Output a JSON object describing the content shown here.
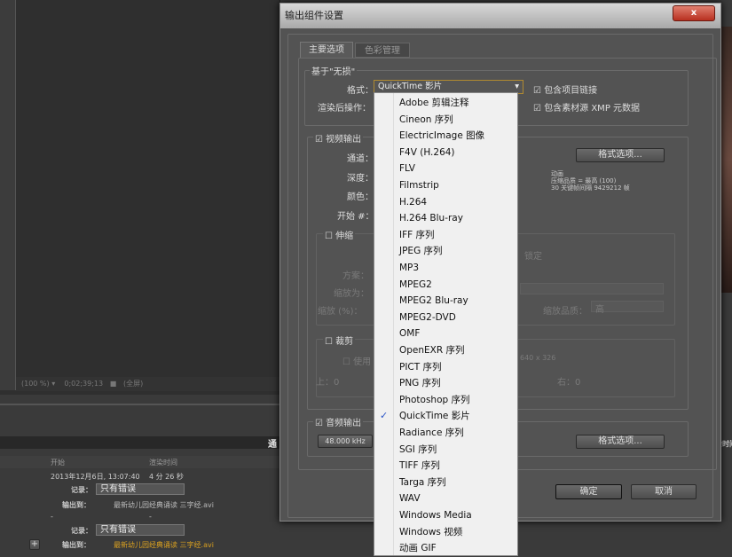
{
  "viewer_toolbar": {
    "zoom": "(100 %)",
    "timecode": "0;02;39;13",
    "view": "(全屏)"
  },
  "queue": {
    "columns": [
      "开始",
      "渲染时间"
    ],
    "rows": [
      {
        "start": "2013年12月6日, 13:07:40",
        "render_time": "4 分 26 秒",
        "log_label": "记录：",
        "log_value": "只有错误",
        "output_label": "输出到：",
        "output_file": "最新幼儿园经典诵读 三字经.avi"
      },
      {
        "start": "-",
        "render_time": "-",
        "log_label": "记录：",
        "log_value": "只有错误",
        "output_label": "输出到：",
        "output_file": "最新幼儿园经典诵读 三字经.avi"
      }
    ],
    "panel_label_left": "通",
    "panel_label_right": "余时间"
  },
  "dialog": {
    "title": "输出组件设置",
    "close": "x",
    "tabs": [
      "主要选项",
      "色彩管理"
    ],
    "based_on": "基于\"无损\"",
    "format_label": "格式：",
    "format_value": "QuickTime 影片",
    "post_render_label": "渲染后操作：",
    "include_project_link": "包含项目链接",
    "include_xmp": "包含素材源 XMP 元数据",
    "video_output": "视频输出",
    "channels_label": "通道：",
    "depth_label": "深度：",
    "color_label": "颜色：",
    "start_label": "开始 #：",
    "format_options": "格式选项...",
    "info": [
      "动画",
      "压缩品质 = 最高 (100)",
      "30 关键帧间隔 9429212 帧"
    ],
    "stretch": "伸缩",
    "lock": "锁定",
    "scheme_label": "方案：",
    "stretch_to_label": "缩放为：",
    "stretch_pct_label": "缩放 (%)：",
    "stretch_quality_label": "缩放品质：",
    "stretch_quality_value": "高",
    "crop": "裁剪",
    "use_roi": "使用",
    "crop_size": "640 x 326",
    "top_label": "上：0",
    "right_label": "右：0",
    "audio_output": "音频输出",
    "sample_rate": "48.000 kHz",
    "audio_format_options": "格式选项...",
    "ok": "确定",
    "cancel": "取消"
  },
  "format_menu": {
    "selected": "QuickTime 影片",
    "items": [
      "Adobe 剪辑注释",
      "Cineon 序列",
      "ElectricImage 图像",
      "F4V (H.264)",
      "FLV",
      "Filmstrip",
      "H.264",
      "H.264 Blu-ray",
      "IFF 序列",
      "JPEG 序列",
      "MP3",
      "MPEG2",
      "MPEG2 Blu-ray",
      "MPEG2-DVD",
      "OMF",
      "OpenEXR 序列",
      "PICT 序列",
      "PNG 序列",
      "Photoshop 序列",
      "QuickTime 影片",
      "Radiance 序列",
      "SGI 序列",
      "TIFF 序列",
      "Targa 序列",
      "WAV",
      "Windows Media",
      "Windows 视频",
      "动画 GIF"
    ]
  },
  "colors": {
    "output_file_active": "#d9a020",
    "menu_check": "#2a55c8",
    "close_button": "#c84030"
  }
}
